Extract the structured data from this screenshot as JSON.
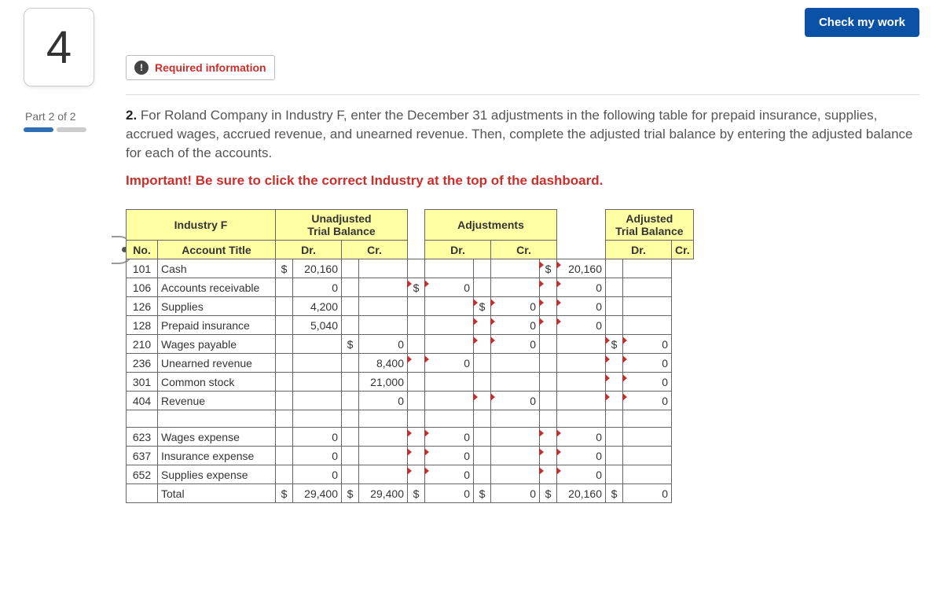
{
  "left": {
    "question_number": "4",
    "part_label": "Part 2 of 2"
  },
  "header": {
    "check_button": "Check my work",
    "required_info_badge": "!",
    "required_info": "Required information"
  },
  "instruction": {
    "num": "2.",
    "text": "For Roland Company in Industry F, enter the December 31 adjustments in the following table for prepaid insurance, supplies, accrued wages, accrued revenue, and unearned revenue. Then, complete the adjusted trial balance by entering the adjusted balance for each of the accounts."
  },
  "important": "Important! Be sure to click the correct Industry at the top of the dashboard.",
  "table": {
    "industry": "Industry F",
    "section_unadjusted": "Unadjusted\nTrial Balance",
    "section_adjustments": "Adjustments",
    "section_adjusted": "Adjusted\nTrial Balance",
    "col_no": "No.",
    "col_title": "Account Title",
    "col_dr": "Dr.",
    "col_cr": "Cr.",
    "rows": [
      {
        "no": "101",
        "title": "Cash",
        "u_dr_cur": "$",
        "u_dr": "20,160",
        "u_cr_cur": "",
        "u_cr": "",
        "a_dr_cur": "",
        "a_dr": "",
        "a_cr_cur": "",
        "a_cr": "",
        "at_dr_cur": "$",
        "at_dr": "20,160",
        "at_cr_cur": "",
        "at_cr": ""
      },
      {
        "no": "106",
        "title": "Accounts receivable",
        "u_dr_cur": "",
        "u_dr": "0",
        "u_cr_cur": "",
        "u_cr": "",
        "a_dr_cur": "$",
        "a_dr": "0",
        "a_cr_cur": "",
        "a_cr": "",
        "at_dr_cur": "",
        "at_dr": "0",
        "at_cr_cur": "",
        "at_cr": ""
      },
      {
        "no": "126",
        "title": "Supplies",
        "u_dr_cur": "",
        "u_dr": "4,200",
        "u_cr_cur": "",
        "u_cr": "",
        "a_dr_cur": "",
        "a_dr": "",
        "a_cr_cur": "$",
        "a_cr": "0",
        "at_dr_cur": "",
        "at_dr": "0",
        "at_cr_cur": "",
        "at_cr": ""
      },
      {
        "no": "128",
        "title": "Prepaid insurance",
        "u_dr_cur": "",
        "u_dr": "5,040",
        "u_cr_cur": "",
        "u_cr": "",
        "a_dr_cur": "",
        "a_dr": "",
        "a_cr_cur": "",
        "a_cr": "0",
        "at_dr_cur": "",
        "at_dr": "0",
        "at_cr_cur": "",
        "at_cr": ""
      },
      {
        "no": "210",
        "title": "Wages payable",
        "u_dr_cur": "",
        "u_dr": "",
        "u_cr_cur": "$",
        "u_cr": "0",
        "a_dr_cur": "",
        "a_dr": "",
        "a_cr_cur": "",
        "a_cr": "0",
        "at_dr_cur": "",
        "at_dr": "",
        "at_cr_cur": "$",
        "at_cr": "0"
      },
      {
        "no": "236",
        "title": "Unearned revenue",
        "u_dr_cur": "",
        "u_dr": "",
        "u_cr_cur": "",
        "u_cr": "8,400",
        "a_dr_cur": "",
        "a_dr": "0",
        "a_cr_cur": "",
        "a_cr": "",
        "at_dr_cur": "",
        "at_dr": "",
        "at_cr_cur": "",
        "at_cr": "0"
      },
      {
        "no": "301",
        "title": "Common stock",
        "u_dr_cur": "",
        "u_dr": "",
        "u_cr_cur": "",
        "u_cr": "21,000",
        "a_dr_cur": "",
        "a_dr": "",
        "a_cr_cur": "",
        "a_cr": "",
        "at_dr_cur": "",
        "at_dr": "",
        "at_cr_cur": "",
        "at_cr": "0"
      },
      {
        "no": "404",
        "title": "Revenue",
        "u_dr_cur": "",
        "u_dr": "",
        "u_cr_cur": "",
        "u_cr": "0",
        "a_dr_cur": "",
        "a_dr": "",
        "a_cr_cur": "",
        "a_cr": "0",
        "at_dr_cur": "",
        "at_dr": "",
        "at_cr_cur": "",
        "at_cr": "0"
      }
    ],
    "rows2": [
      {
        "no": "623",
        "title": "Wages expense",
        "u_dr": "0",
        "a_dr": "0",
        "at_dr": "0"
      },
      {
        "no": "637",
        "title": "Insurance expense",
        "u_dr": "0",
        "a_dr": "0",
        "at_dr": "0"
      },
      {
        "no": "652",
        "title": "Supplies expense",
        "u_dr": "0",
        "a_dr": "0",
        "at_dr": "0"
      }
    ],
    "total": {
      "label": "Total",
      "u_dr_cur": "$",
      "u_dr": "29,400",
      "u_cr_cur": "$",
      "u_cr": "29,400",
      "a_dr_cur": "$",
      "a_dr": "0",
      "a_cr_cur": "$",
      "a_cr": "0",
      "at_dr_cur": "$",
      "at_dr": "20,160",
      "at_cr_cur": "$",
      "at_cr": "0"
    }
  }
}
